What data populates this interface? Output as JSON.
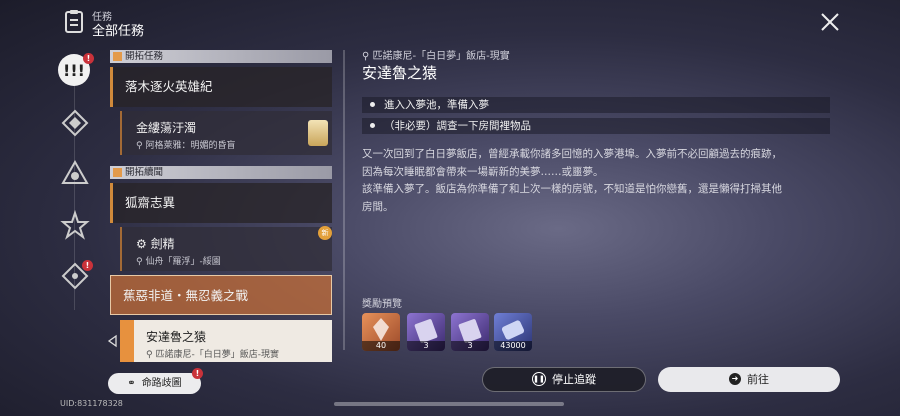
{
  "header": {
    "subtitle": "任務",
    "title": "全部任務"
  },
  "sidebar": {
    "badges": [
      "!",
      "!",
      "!"
    ]
  },
  "categories": [
    {
      "label": "開拓任務",
      "quests": [
        {
          "title": "落木逐火英雄紀"
        },
        {
          "title": "金縷蕩汙濁",
          "location": "阿格萊雅：明媚的昏盲"
        }
      ]
    },
    {
      "label": "開拓續聞",
      "quests": [
        {
          "title": "狐齋志異"
        },
        {
          "title": "劍精",
          "location": "仙舟「羅浮」-綏園",
          "badge": "新"
        },
        {
          "title": "蕉惡非道・無忍義之戰"
        },
        {
          "title": "安達魯之猿",
          "location": "匹諾康尼-「白日夢」飯店-現實"
        }
      ]
    }
  ],
  "detail": {
    "location": "匹諾康尼-「白日夢」飯店-現實",
    "title": "安達魯之猿",
    "objectives": [
      "進入入夢池，準備入夢",
      "（非必要）調查一下房間裡物品"
    ],
    "description": "又一次回到了白日夢飯店，曾經承載你諸多回憶的入夢港埠。入夢前不必回顧過去的痕跡，\n因為每次睡眠都會帶來一場嶄新的美夢……或噩夢。\n該準備入夢了。飯店為你準備了和上次一樣的房號，不知道是怕你戀舊，還是懶得打掃其他\n房間。",
    "rewards_label": "獎勵預覽",
    "rewards": [
      {
        "icon": "stellar-jade-icon",
        "count": "40",
        "color": "#c46a3a"
      },
      {
        "icon": "ticket-icon",
        "count": "3",
        "color": "#6a4fa8"
      },
      {
        "icon": "ticket-icon",
        "count": "3",
        "color": "#6a4fa8"
      },
      {
        "icon": "credit-icon",
        "count": "43000",
        "color": "#4b57a8"
      }
    ]
  },
  "buttons": {
    "stop": "停止追蹤",
    "go": "前往",
    "path": "命路歧圖"
  },
  "uid": "UID:831178328"
}
